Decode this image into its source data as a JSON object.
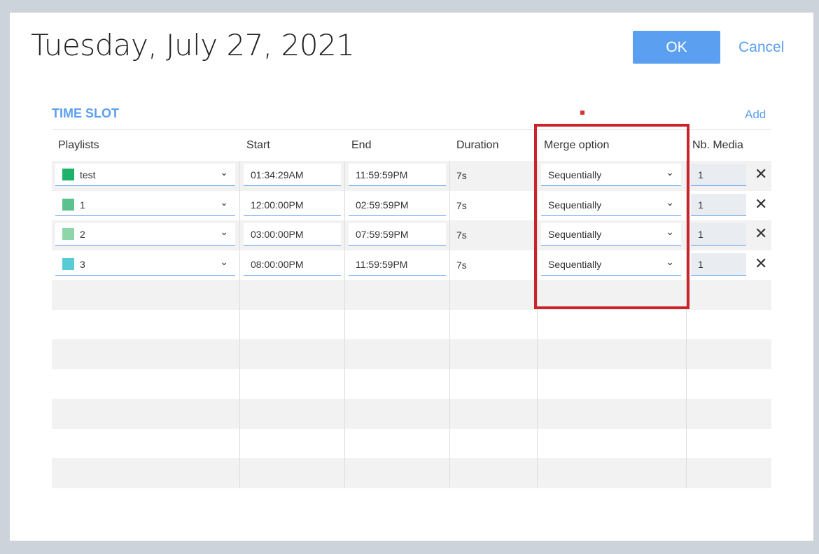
{
  "header": {
    "title": "Tuesday, July 27, 2021",
    "ok_label": "OK",
    "cancel_label": "Cancel"
  },
  "section": {
    "title": "TIME SLOT",
    "add_label": "Add"
  },
  "columns": [
    "Playlists",
    "Start",
    "End",
    "Duration",
    "Merge option",
    "Nb. Media"
  ],
  "rows": [
    {
      "playlist": "test",
      "color": "#1db26b",
      "start": "01:34:29AM",
      "end": "11:59:59PM",
      "duration": "7s",
      "merge": "Sequentially",
      "nb_media": "1"
    },
    {
      "playlist": "1",
      "color": "#5bc28f",
      "start": "12:00:00PM",
      "end": "02:59:59PM",
      "duration": "7s",
      "merge": "Sequentially",
      "nb_media": "1"
    },
    {
      "playlist": "2",
      "color": "#8ed6aa",
      "start": "03:00:00PM",
      "end": "07:59:59PM",
      "duration": "7s",
      "merge": "Sequentially",
      "nb_media": "1"
    },
    {
      "playlist": "3",
      "color": "#56ccd6",
      "start": "08:00:00PM",
      "end": "11:59:59PM",
      "duration": "7s",
      "merge": "Sequentially",
      "nb_media": "1"
    }
  ],
  "colors": {
    "accent": "#5b9ff0",
    "highlight": "#cc2229"
  },
  "icons": {
    "delete": "close-icon",
    "dropdown": "chevron-down-icon"
  }
}
